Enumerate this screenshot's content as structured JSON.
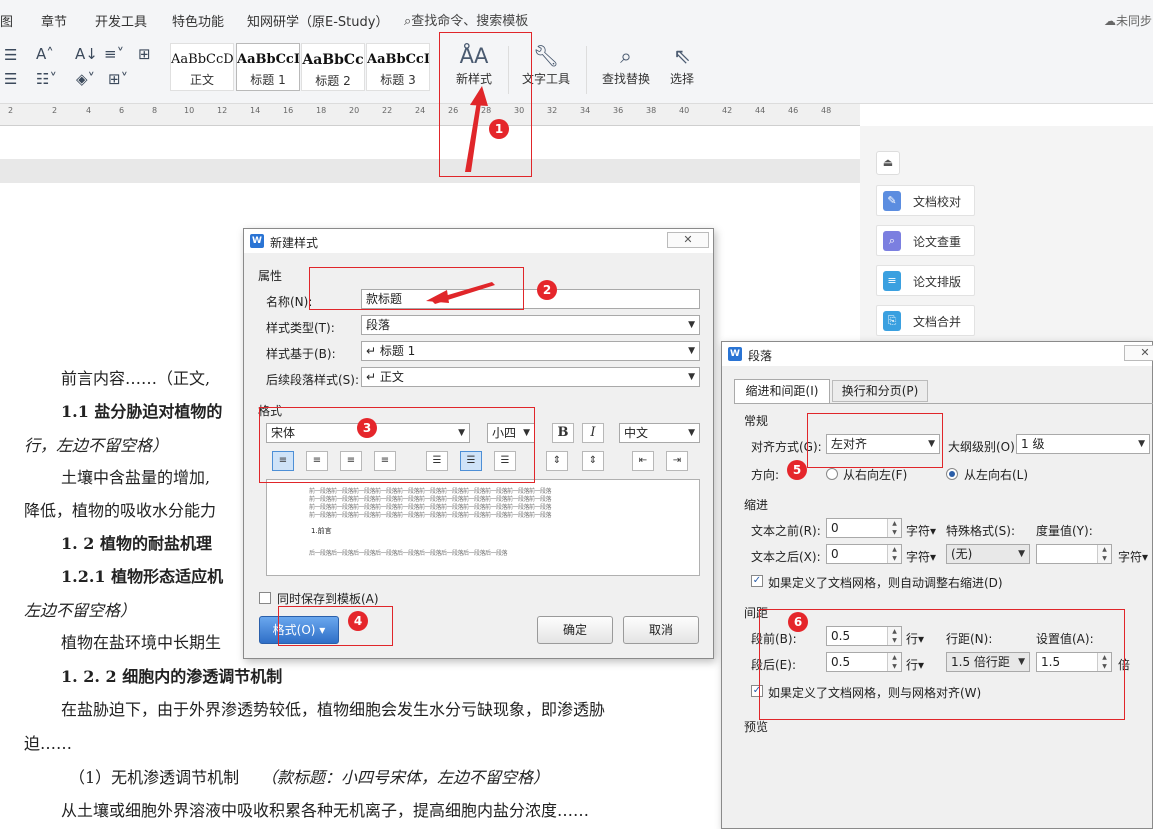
{
  "menu": {
    "items": [
      "图",
      "章节",
      "开发工具",
      "特色功能",
      "知网研学（原E-Study）"
    ],
    "search_text": "查找命令、搜索模板",
    "sync_status": "未同步"
  },
  "ribbon": {
    "styles": [
      {
        "sample": "AaBbCcDd",
        "name": "正文"
      },
      {
        "sample": "AaBbCcD",
        "name": "标题 1"
      },
      {
        "sample": "AaBbCc",
        "name": "标题 2"
      },
      {
        "sample": "AaBbCcI",
        "name": "标题 3"
      }
    ],
    "new_style": "新样式",
    "text_tools": "文字工具",
    "find_replace": "查找替换",
    "select": "选择"
  },
  "ruler": [
    "2",
    "2",
    "4",
    "6",
    "8",
    "10",
    "12",
    "14",
    "16",
    "18",
    "20",
    "22",
    "24",
    "26",
    "28",
    "30",
    "32",
    "34",
    "36",
    "38",
    "40",
    "42",
    "44",
    "46",
    "48"
  ],
  "side_panel": {
    "items": [
      "文档校对",
      "论文查重",
      "论文排版",
      "文档合并"
    ]
  },
  "document": {
    "lines": [
      "前言内容……（正文,",
      "1.1 盐分胁迫对植物的",
      "行，左边不留空格）",
      "土壤中含盐量的增加,",
      "降低，植物的吸收水分能力",
      "1. 2 植物的耐盐机理",
      "1.2.1 植物形态适应机",
      "左边不留空格）",
      "植物在盐环境中长期生",
      "1. 2. 2 细胞内的渗透调节机制",
      "在盐胁迫下，由于外界渗透势较低，植物细胞会发生水分亏缺现象，即渗透胁",
      "迫……",
      "（1）无机渗透调节机制",
      "（款标题：小四号宋体，左边不留空格）",
      "从土壤或细胞外界溶液中吸收积累各种无机离子，提高细胞内盐分浓度……"
    ]
  },
  "new_style_dialog": {
    "title": "新建样式",
    "close": "关闭",
    "attributes_section": "属性",
    "name_label": "名称(N):",
    "name_value": "款标题",
    "type_label": "样式类型(T):",
    "type_value": "段落",
    "based_label": "样式基于(B):",
    "based_value": "↵ 标题 1",
    "next_label": "后续段落样式(S):",
    "next_value": "↵ 正文",
    "format_section": "格式",
    "font": "宋体",
    "size": "小四",
    "bold": "B",
    "italic": "I",
    "lang": "中文",
    "preview_text": "前一段落前一段落前一段落前一段落前一段落前一段落前一段落前一段落前一段落前一段落前一段落",
    "preview_sample": "1.前言",
    "preview_after": "后一段落后一段落后一段落后一段落后一段落后一段落后一段落后一段落后一段落",
    "save_template": "同时保存到模板(A)",
    "format_button": "格式(O)",
    "ok": "确定",
    "cancel": "取消"
  },
  "paragraph_dialog": {
    "title": "段落",
    "tabs": [
      "缩进和间距(I)",
      "换行和分页(P)"
    ],
    "general_section": "常规",
    "align_label": "对齐方式(G):",
    "align_value": "左对齐",
    "outline_label": "大纲级别(O):",
    "outline_value": "1 级",
    "direction_label": "方向:",
    "rtl": "从右向左(F)",
    "ltr": "从左向右(L)",
    "indent_section": "缩进",
    "before_text_label": "文本之前(R):",
    "before_text_value": "0",
    "after_text_label": "文本之后(X):",
    "after_text_value": "0",
    "unit_char": "字符",
    "special_label": "特殊格式(S):",
    "special_value": "(无)",
    "measure_label": "度量值(Y):",
    "grid_indent": "如果定义了文档网格，则自动调整右缩进(D)",
    "spacing_section": "间距",
    "before_label": "段前(B):",
    "before_value": "0.5",
    "after_label": "段后(E):",
    "after_value": "0.5",
    "unit_line": "行",
    "line_spacing_label": "行距(N):",
    "line_spacing_value": "1.5 倍行距",
    "set_value_label": "设置值(A):",
    "set_value": "1.5",
    "unit_times": "倍",
    "grid_align": "如果定义了文档网格，则与网格对齐(W)",
    "preview_section": "预览"
  },
  "annotations": [
    "1",
    "2",
    "3",
    "4",
    "5",
    "6"
  ],
  "colors": {
    "annotation": "#e0262a",
    "accent": "#2a74d4"
  }
}
